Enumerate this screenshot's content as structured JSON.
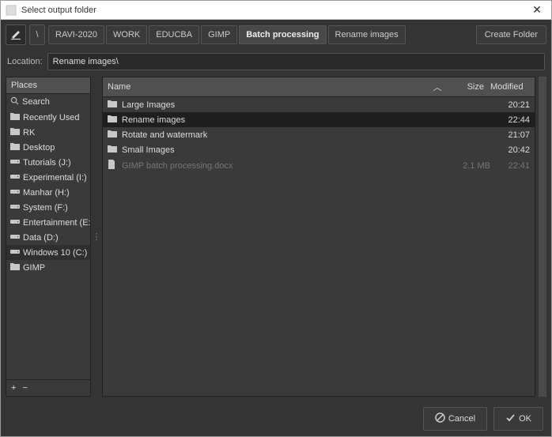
{
  "window": {
    "title": "Select output folder"
  },
  "toolbar": {
    "breadcrumbs": [
      "RAVI-2020",
      "WORK",
      "EDUCBA",
      "GIMP",
      "Batch processing",
      "Rename images"
    ],
    "active_index": 4,
    "create_folder": "Create Folder"
  },
  "location": {
    "label": "Location:",
    "value": "Rename images\\"
  },
  "places": {
    "header": "Places",
    "items": [
      {
        "label": "Search",
        "icon": "search"
      },
      {
        "label": "Recently Used",
        "icon": "folder"
      },
      {
        "label": "RK",
        "icon": "folder"
      },
      {
        "label": "Desktop",
        "icon": "folder"
      },
      {
        "label": "Tutorials (J:)",
        "icon": "drive"
      },
      {
        "label": "Experimental (I:)",
        "icon": "drive"
      },
      {
        "label": "Manhar (H:)",
        "icon": "drive"
      },
      {
        "label": "System (F:)",
        "icon": "drive"
      },
      {
        "label": "Entertainment (E:)",
        "icon": "drive"
      },
      {
        "label": "Data (D:)",
        "icon": "drive"
      },
      {
        "label": "Windows 10 (C:)",
        "icon": "drive",
        "selected": true
      },
      {
        "label": "GIMP",
        "icon": "folder"
      }
    ],
    "add": "+",
    "remove": "−"
  },
  "files": {
    "headers": {
      "name": "Name",
      "size": "Size",
      "modified": "Modified",
      "sort_glyph": "︿"
    },
    "rows": [
      {
        "name": "Large Images",
        "icon": "folder",
        "size": "",
        "modified": "20:21"
      },
      {
        "name": "Rename images",
        "icon": "folder",
        "size": "",
        "modified": "22:44",
        "selected": true
      },
      {
        "name": "Rotate and watermark",
        "icon": "folder",
        "size": "",
        "modified": "21:07"
      },
      {
        "name": "Small Images",
        "icon": "folder",
        "size": "",
        "modified": "20:42"
      },
      {
        "name": "GIMP batch processing.docx",
        "icon": "doc",
        "size": "2.1 MB",
        "modified": "22:41",
        "disabled": true
      }
    ]
  },
  "buttons": {
    "cancel": "Cancel",
    "ok": "OK"
  }
}
